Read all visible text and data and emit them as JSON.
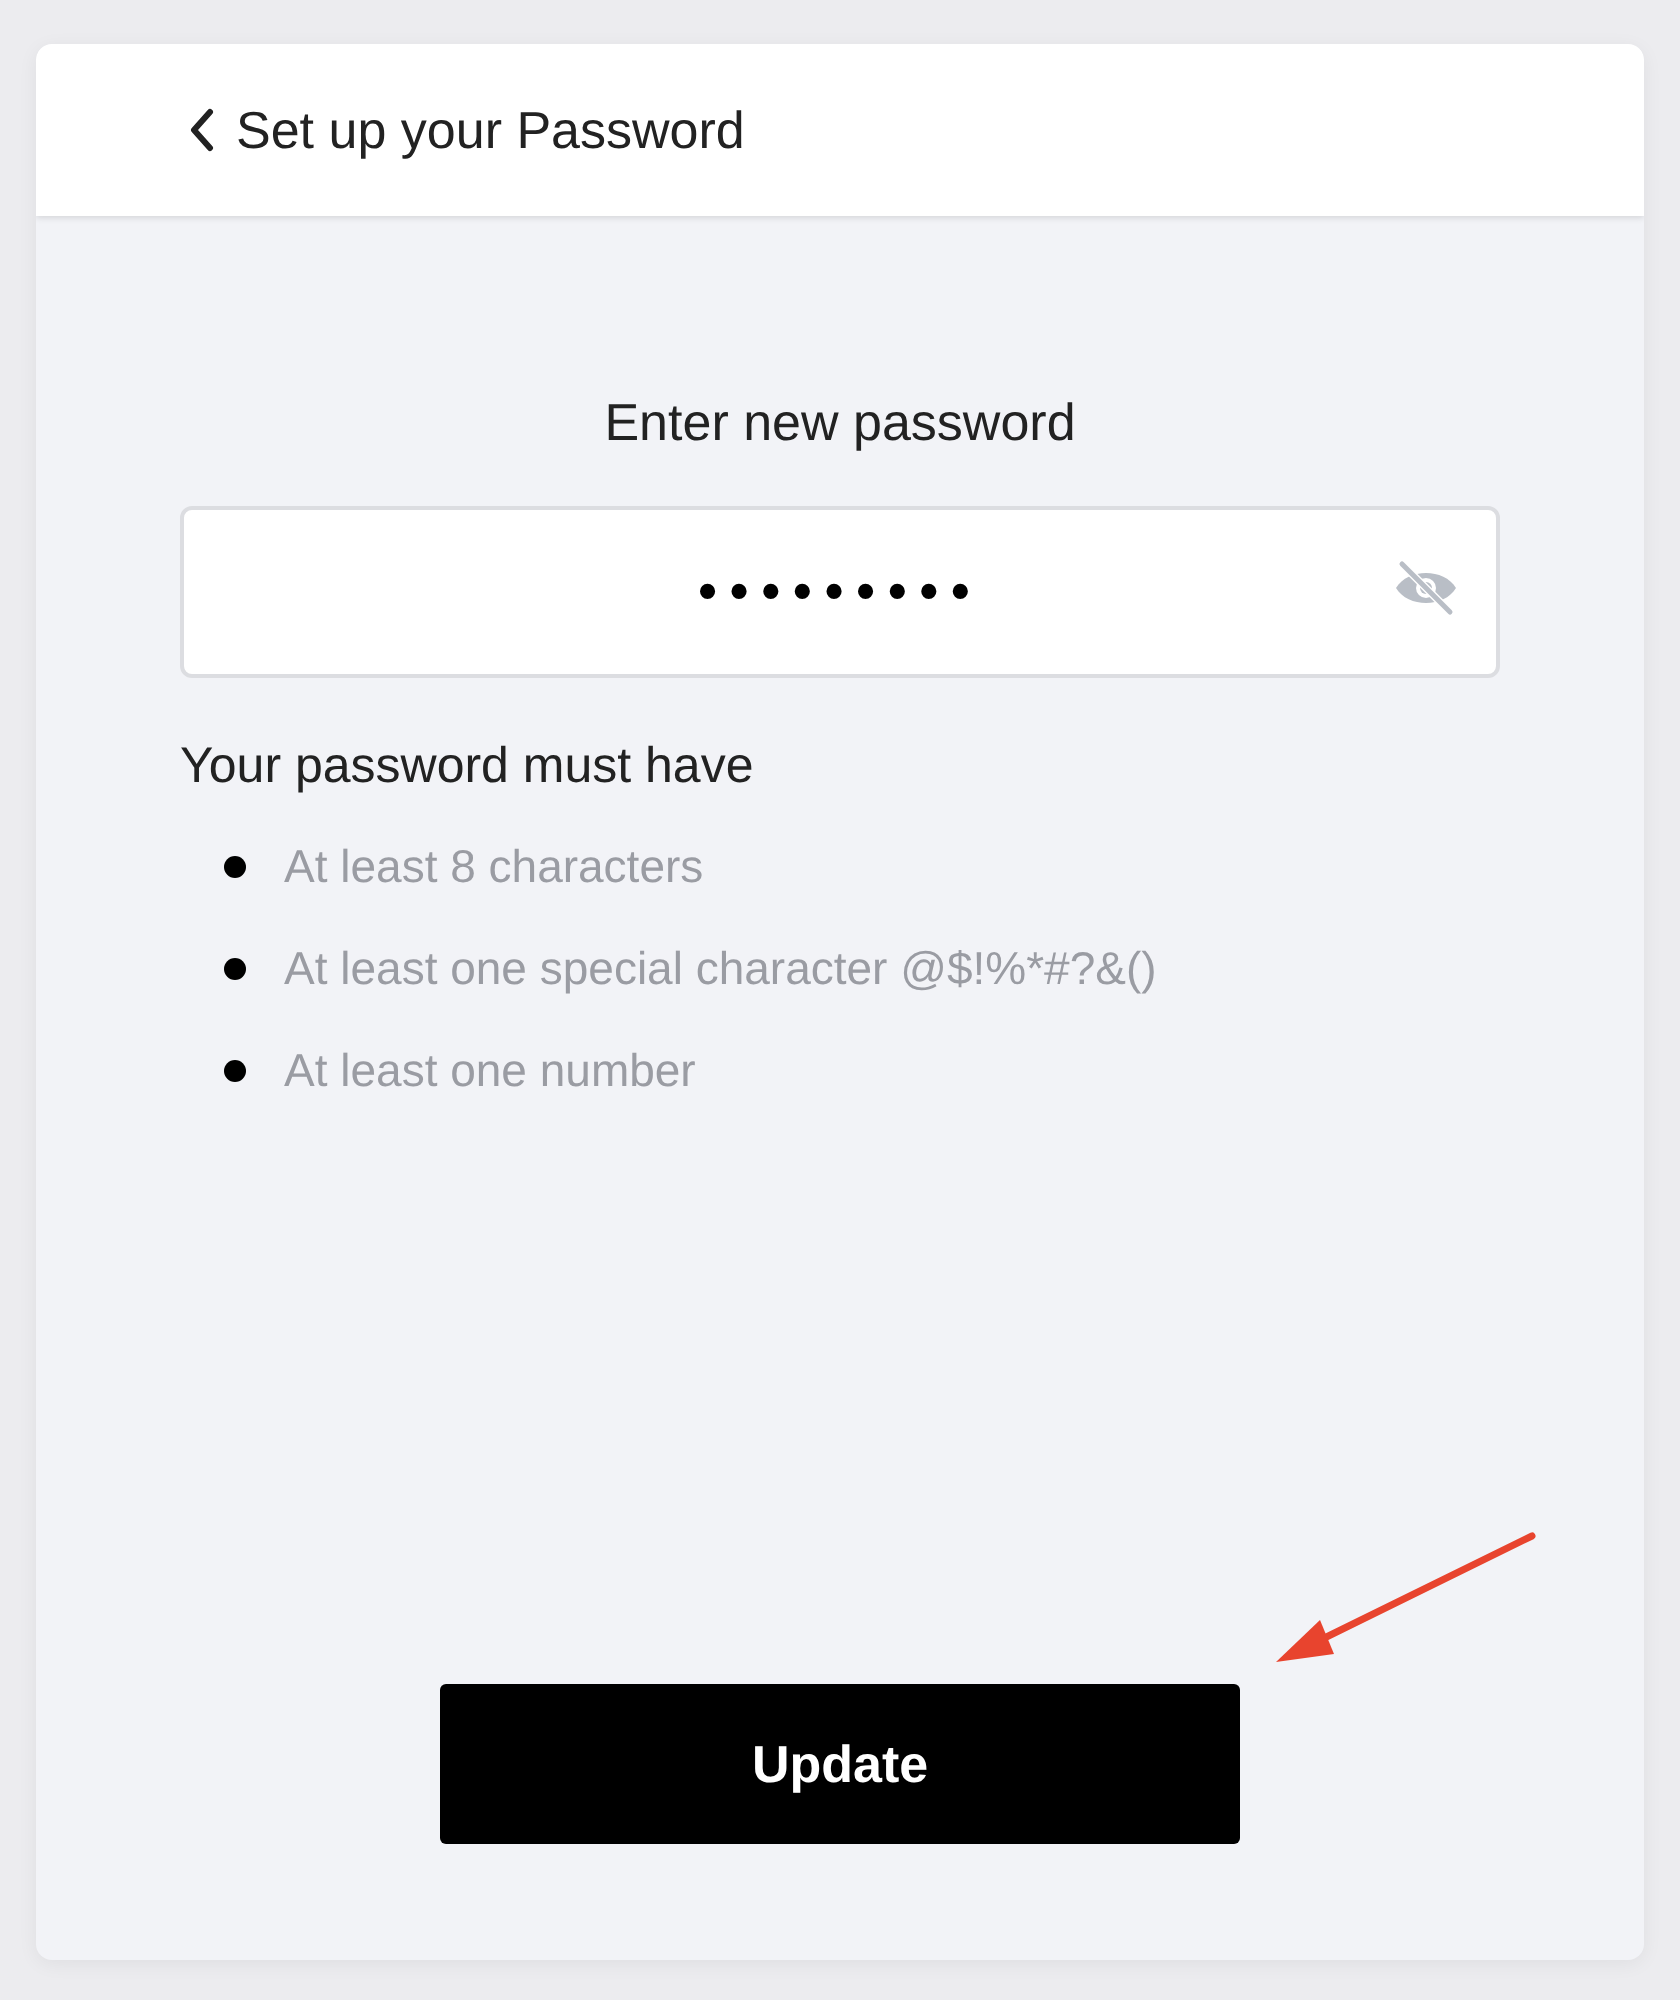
{
  "header": {
    "title": "Set up your Password"
  },
  "form": {
    "label": "Enter new password",
    "field": {
      "value": "•••••••••",
      "reveal_hidden": true
    },
    "rules_title": "Your password must have",
    "rules": [
      {
        "text": "At least 8 characters"
      },
      {
        "text": "At least one special character @$!%*#?&()"
      },
      {
        "text": "At least one number"
      }
    ],
    "submit": "Update"
  },
  "annotation": {
    "kind": "arrow"
  }
}
